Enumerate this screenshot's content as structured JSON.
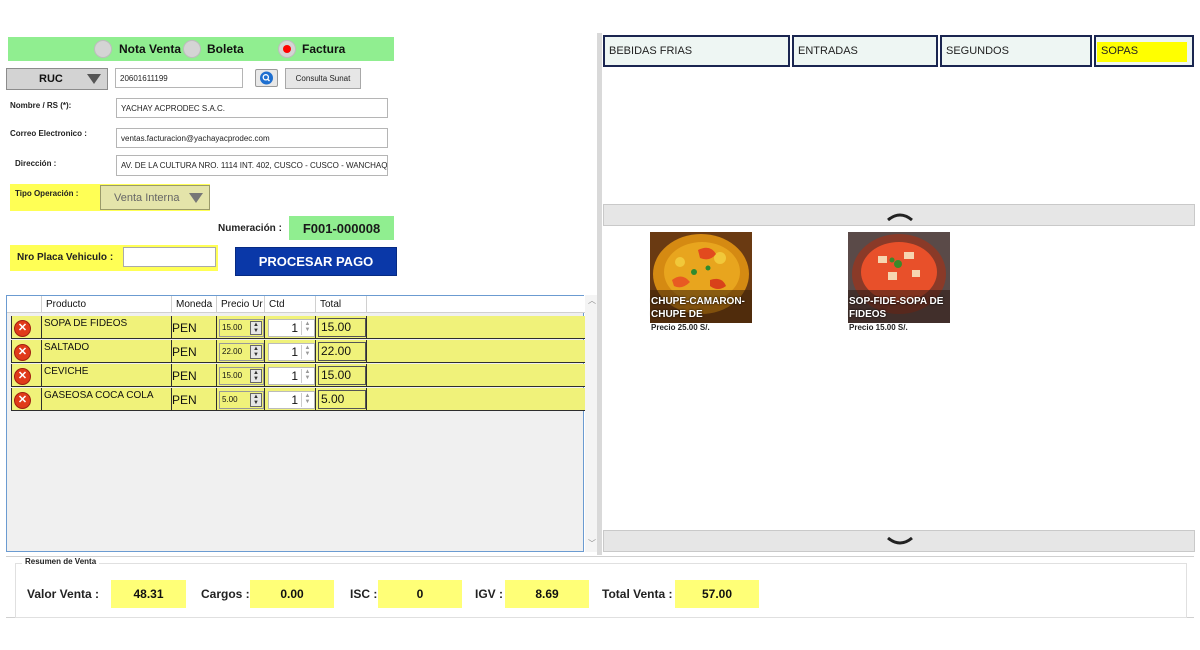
{
  "doc_types": [
    {
      "label": "Nota Venta",
      "selected": false
    },
    {
      "label": "Boleta",
      "selected": false
    },
    {
      "label": "Factura",
      "selected": true
    }
  ],
  "doc_id_type": "RUC",
  "ruc_value": "20601611199",
  "consulta_sunat_label": "Consulta Sunat",
  "fields": {
    "nombre_label": "Nombre / RS (*):",
    "nombre_value": "YACHAY ACPRODEC S.A.C.",
    "correo_label": "Correo Electronico :",
    "correo_value": "ventas.facturacion@yachayacprodec.com",
    "direccion_label": "Dirección :",
    "direccion_value": "AV. DE LA CULTURA NRO. 1114 INT. 402, CUSCO - CUSCO - WANCHAQ"
  },
  "tipo_operacion_label": "Tipo Operación :",
  "tipo_operacion_value": "Venta Interna",
  "numeracion_label": "Numeración :",
  "numeracion_value": "F001-000008",
  "placa_label": "Nro Placa Vehiculo :",
  "placa_value": "",
  "procesar_label": "PROCESAR PAGO",
  "grid": {
    "headers": [
      "Producto",
      "Moneda",
      "Precio Ur",
      "Ctd",
      "Total"
    ],
    "rows": [
      {
        "producto": "SOPA DE FIDEOS",
        "moneda": "PEN",
        "precio": "15.00",
        "ctd": "1",
        "total": "15.00"
      },
      {
        "producto": "SALTADO",
        "moneda": "PEN",
        "precio": "22.00",
        "ctd": "1",
        "total": "22.00"
      },
      {
        "producto": "CEVICHE",
        "moneda": "PEN",
        "precio": "15.00",
        "ctd": "1",
        "total": "15.00"
      },
      {
        "producto": "GASEOSA COCA COLA",
        "moneda": "PEN",
        "precio": "5.00",
        "ctd": "1",
        "total": "5.00"
      }
    ]
  },
  "categories": [
    {
      "label": "BEBIDAS FRIAS",
      "selected": false
    },
    {
      "label": "ENTRADAS",
      "selected": false
    },
    {
      "label": "SEGUNDOS",
      "selected": false
    },
    {
      "label": "SOPAS",
      "selected": true
    }
  ],
  "products": [
    {
      "name": "CHUPE-CAMARON-CHUPE DE",
      "price": "Precio 25.00 S/."
    },
    {
      "name": "SOP-FIDE-SOPA DE FIDEOS",
      "price": "Precio 15.00 S/."
    }
  ],
  "summary": {
    "legend": "Resumen de Venta",
    "valor_venta_label": "Valor Venta :",
    "valor_venta": "48.31",
    "cargos_label": "Cargos :",
    "cargos": "0.00",
    "isc_label": "ISC :",
    "isc": "0",
    "igv_label": "IGV :",
    "igv": "8.69",
    "total_label": "Total Venta :",
    "total": "57.00"
  },
  "colors": {
    "accent_green": "#90ee90",
    "row_yellow": "#f0f27a",
    "procesar_blue": "#0a38a8",
    "delete_red": "#e03a1a"
  }
}
